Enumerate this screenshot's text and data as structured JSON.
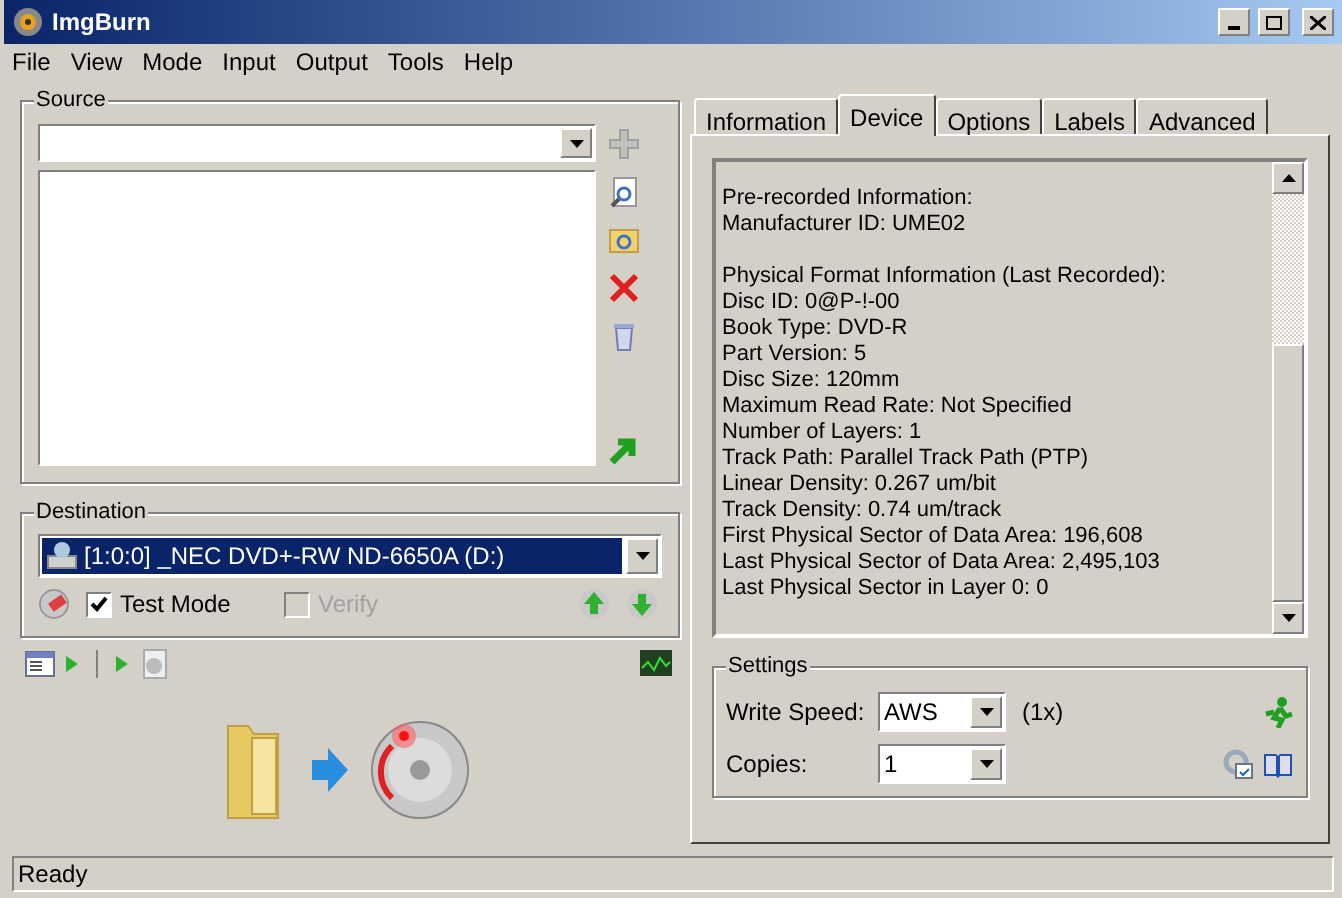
{
  "window": {
    "title": "ImgBurn"
  },
  "menu": [
    "File",
    "View",
    "Mode",
    "Input",
    "Output",
    "Tools",
    "Help"
  ],
  "source": {
    "label": "Source"
  },
  "destination": {
    "label": "Destination",
    "drive": "[1:0:0] _NEC DVD+-RW ND-6650A (D:)",
    "options": [
      {
        "kind": "checkbox",
        "label": "Test Mode",
        "checked": true,
        "disabled": false
      },
      {
        "kind": "checkbox",
        "label": "Verify",
        "checked": false,
        "disabled": true
      }
    ]
  },
  "tabs": [
    {
      "label": "Information",
      "selected": false
    },
    {
      "label": "Device",
      "selected": true
    },
    {
      "label": "Options",
      "selected": false
    },
    {
      "label": "Labels",
      "selected": false
    },
    {
      "label": "Advanced",
      "selected": false
    }
  ],
  "device_info": [
    [
      "Pre-recorded Information:",
      "Manufacturer ID: UME02"
    ],
    [
      "Physical Format Information (Last Recorded):",
      "Disc ID: 0@P-!-00",
      "Book Type: DVD-R",
      "Part Version: 5",
      "Disc Size: 120mm",
      "Maximum Read Rate: Not Specified",
      "Number of Layers: 1",
      "Track Path: Parallel Track Path (PTP)",
      "Linear Density: 0.267 um/bit",
      "Track Density: 0.74 um/track",
      "First Physical Sector of Data Area: 196,608",
      "Last Physical Sector of Data Area: 2,495,103",
      "Last Physical Sector in Layer 0: 0"
    ]
  ],
  "settings": {
    "label": "Settings",
    "write_speed": {
      "label": "Write Speed:",
      "value": "AWS",
      "suffix": "(1x)"
    },
    "copies": {
      "label": "Copies:",
      "value": "1"
    }
  },
  "status_bar": "Ready"
}
